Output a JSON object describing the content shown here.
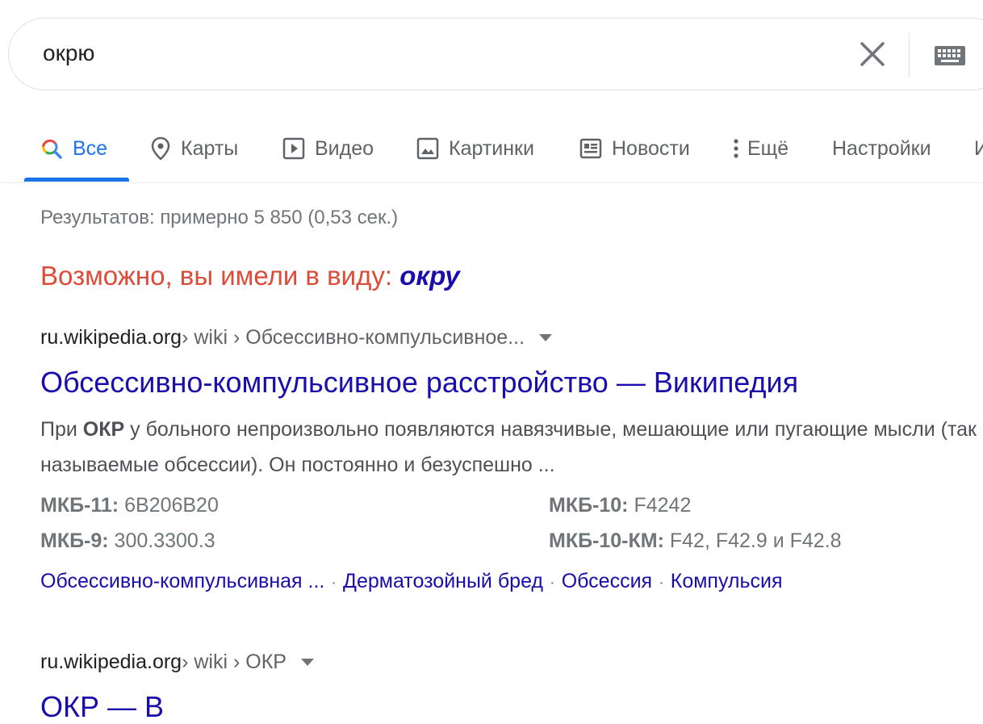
{
  "search": {
    "query": "окрю"
  },
  "tabs": [
    {
      "label": "Все",
      "icon": "search-icon",
      "active": true
    },
    {
      "label": "Карты",
      "icon": "map-pin-icon"
    },
    {
      "label": "Видео",
      "icon": "video-icon"
    },
    {
      "label": "Картинки",
      "icon": "image-icon"
    },
    {
      "label": "Новости",
      "icon": "news-icon"
    },
    {
      "label": "Ещё",
      "icon": "more-vert-icon"
    },
    {
      "label": "Настройки"
    },
    {
      "label": "И"
    }
  ],
  "stats": "Результатов: примерно 5 850 (0,53 сек.)",
  "did_you_mean": {
    "prefix": "Возможно, вы имели в виду: ",
    "suggestion": "окру"
  },
  "results": [
    {
      "domain": "ru.wikipedia.org",
      "path": " › wiki › Обсессивно-компульсивное...",
      "title": "Обсессивно-компульсивное расстройство — Википедия",
      "snippet_pre": "При ",
      "snippet_bold": "ОКР",
      "snippet_post": " у больного непроизвольно появляются навязчивые, мешающие или пугающие мысли (так называемые обсессии). Он постоянно и безуспешно ...",
      "facts": [
        {
          "label": "МКБ-11:",
          "value": " 6B206B20"
        },
        {
          "label": "МКБ-10:",
          "value": " F4242"
        },
        {
          "label": "МКБ-9:",
          "value": " 300.3300.3"
        },
        {
          "label": "МКБ-10-КМ:",
          "value": " F42, F42.9 и F42.8"
        }
      ],
      "sitelinks": [
        "Обсессивно-компульсивная ...",
        "Дерматозойный бред",
        "Обсессия",
        "Компульсия"
      ]
    },
    {
      "domain": "ru.wikipedia.org",
      "path": " › wiki › ОКР",
      "title": "ОКР — В"
    }
  ],
  "colors": {
    "link": "#1a0dab",
    "accent": "#1a73e8",
    "suggest_red": "#dd4b39",
    "muted": "#70757a"
  }
}
